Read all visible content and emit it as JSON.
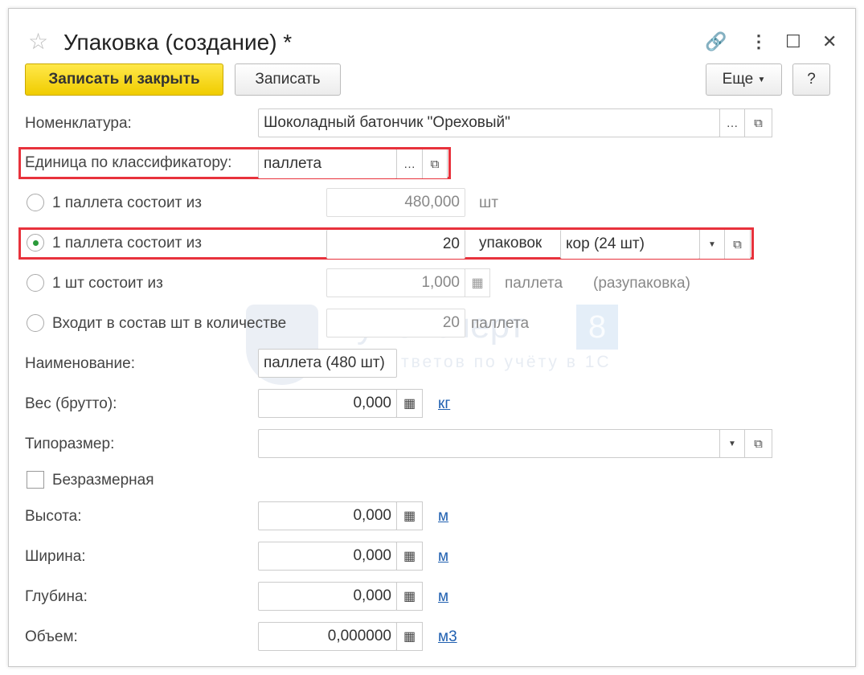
{
  "window": {
    "title": "Упаковка (создание) *"
  },
  "toolbar": {
    "save_close": "Записать и закрыть",
    "save": "Записать",
    "more": "Еще",
    "help": "?"
  },
  "fields": {
    "nomenclature": {
      "label": "Номенклатура:",
      "value": "Шоколадный батончик \"Ореховый\""
    },
    "unit": {
      "label": "Единица по классификатору:",
      "value": "паллета"
    },
    "opt1": {
      "label": "1 паллета состоит из",
      "value": "480,000",
      "unit": "шт"
    },
    "opt2": {
      "label": "1 паллета состоит из",
      "value": "20",
      "unit": "упаковок",
      "pack": "кор (24 шт)"
    },
    "opt3": {
      "label": "1 шт состоит из",
      "value": "1,000",
      "unit": "паллета",
      "note": "(разупаковка)"
    },
    "opt4": {
      "label": "Входит в состав шт в количестве",
      "value": "20",
      "unit": "паллета"
    },
    "name": {
      "label": "Наименование:",
      "value": "паллета (480 шт)"
    },
    "weight": {
      "label": "Вес (брутто):",
      "value": "0,000",
      "unit": "кг"
    },
    "size": {
      "label": "Типоразмер:",
      "value": ""
    },
    "dimless": {
      "label": "Безразмерная"
    },
    "height": {
      "label": "Высота:",
      "value": "0,000",
      "unit": "м"
    },
    "width": {
      "label": "Ширина:",
      "value": "0,000",
      "unit": "м"
    },
    "depth": {
      "label": "Глубина:",
      "value": "0,000",
      "unit": "м"
    },
    "volume": {
      "label": "Объем:",
      "value": "0,000000",
      "unit": "м3"
    }
  },
  "watermark": {
    "brand": "БухЭксперт",
    "digit": "8",
    "tagline": "тветов по учёту в 1С"
  }
}
